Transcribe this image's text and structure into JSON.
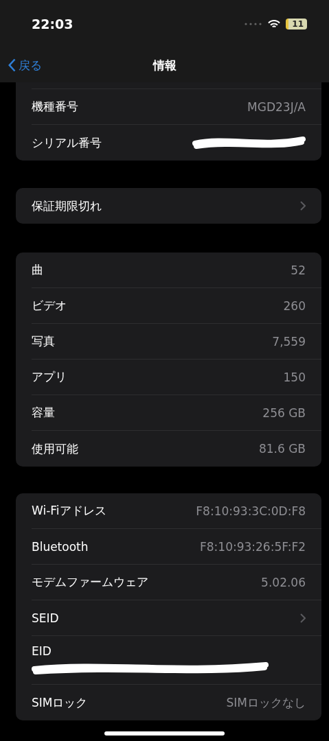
{
  "status_bar": {
    "time": "22:03",
    "battery": "11"
  },
  "nav": {
    "back": "戻る",
    "title": "情報"
  },
  "groups": [
    {
      "cut_top": true,
      "rows": [
        {
          "kind": "value",
          "label": "機種番号",
          "value": "MGD23J/A"
        },
        {
          "kind": "redacted",
          "label": "シリアル番号"
        }
      ]
    },
    {
      "rows": [
        {
          "kind": "link",
          "label": "保証期限切れ"
        }
      ]
    },
    {
      "rows": [
        {
          "kind": "value",
          "label": "曲",
          "value": "52"
        },
        {
          "kind": "value",
          "label": "ビデオ",
          "value": "260"
        },
        {
          "kind": "value",
          "label": "写真",
          "value": "7,559"
        },
        {
          "kind": "value",
          "label": "アプリ",
          "value": "150"
        },
        {
          "kind": "value",
          "label": "容量",
          "value": "256 GB"
        },
        {
          "kind": "value",
          "label": "使用可能",
          "value": "81.6 GB"
        }
      ]
    },
    {
      "rows": [
        {
          "kind": "value",
          "label": "Wi-Fiアドレス",
          "value": "F8:10:93:3C:0D:F8"
        },
        {
          "kind": "value",
          "label": "Bluetooth",
          "value": "F8:10:93:26:5F:F2"
        },
        {
          "kind": "value",
          "label": "モデムファームウェア",
          "value": "5.02.06"
        },
        {
          "kind": "link",
          "label": "SEID"
        },
        {
          "kind": "stacked_redacted",
          "label": "EID"
        },
        {
          "kind": "value",
          "label": "SIMロック",
          "value": "SIMロックなし"
        }
      ]
    }
  ]
}
